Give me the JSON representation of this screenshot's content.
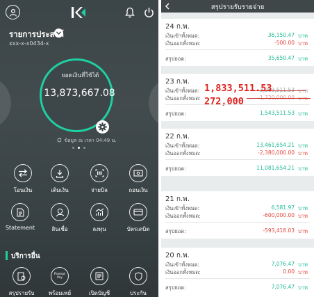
{
  "left": {
    "account": {
      "name": "รายการประสงค์",
      "number": "xxx-x-x0434-x"
    },
    "balance": {
      "label": "ยอดเงินที่ใช้ได้",
      "value": "13,873,667.08"
    },
    "refresh": {
      "text": "ข้อมูล ณ เวลา 04:49 น."
    },
    "quick_actions_row1": [
      {
        "label": "โอนเงิน",
        "icon": "transfer-icon"
      },
      {
        "label": "เติมเงิน",
        "icon": "topup-icon"
      },
      {
        "label": "จ่ายบิล",
        "icon": "barcode-icon"
      },
      {
        "label": "ถอนเงิน",
        "icon": "withdraw-icon"
      }
    ],
    "quick_actions_row2": [
      {
        "label": "Statement",
        "icon": "statement-icon"
      },
      {
        "label": "สินเชื่อ",
        "icon": "loan-icon"
      },
      {
        "label": "ลงทุน",
        "icon": "invest-icon"
      },
      {
        "label": "บัตรเดบิต",
        "icon": "debit-card-icon"
      }
    ],
    "other_services": {
      "title": "บริการอื่น",
      "items": [
        {
          "label": "สรุปรายรับ",
          "icon": "summary-icon"
        },
        {
          "label": "พร้อมเพย์",
          "icon": "promptpay-icon",
          "badge": "Prompt Pay"
        },
        {
          "label": "เปิดบัญชี",
          "icon": "open-account-icon"
        },
        {
          "label": "ประกัน",
          "icon": "insurance-icon"
        }
      ]
    },
    "colors": {
      "accent": "#1fcfa3",
      "bg": "#3c4547"
    }
  },
  "right": {
    "title": "สรุปรายรับรายจ่าย",
    "unit": "บาท",
    "labels": {
      "income": "เงินเข้าทั้งหมด:",
      "expense": "เงินออกทั้งหมด:",
      "net": "สรุปยอด:"
    },
    "days": [
      {
        "date": "24 ก.พ.",
        "income": "36,150.47",
        "expense": "-500.00",
        "net": "35,650.47",
        "net_color": "green"
      },
      {
        "date": "23 ก.พ.",
        "income": "3,263,511.53",
        "expense": "-1,720,000.00",
        "net": "1,543,511.53",
        "net_color": "green",
        "handwritten_income": "1,833,511.53",
        "handwritten_expense": "272,000"
      },
      {
        "date": "22 ก.พ.",
        "income": "13,461,654.21",
        "expense": "-2,380,000.00",
        "net": "11,081,654.21",
        "net_color": "green"
      },
      {
        "date": "21 ก.พ.",
        "income": "6,581.97",
        "expense": "-600,000.00",
        "net": "-593,418.03",
        "net_color": "red"
      },
      {
        "date": "20 ก.พ.",
        "income": "7,076.47",
        "expense": "0.00",
        "net": "7,076.47",
        "net_color": "green"
      }
    ],
    "colors": {
      "income": "#1db994",
      "expense": "#e0473d",
      "annotation": "#e0201b"
    }
  }
}
